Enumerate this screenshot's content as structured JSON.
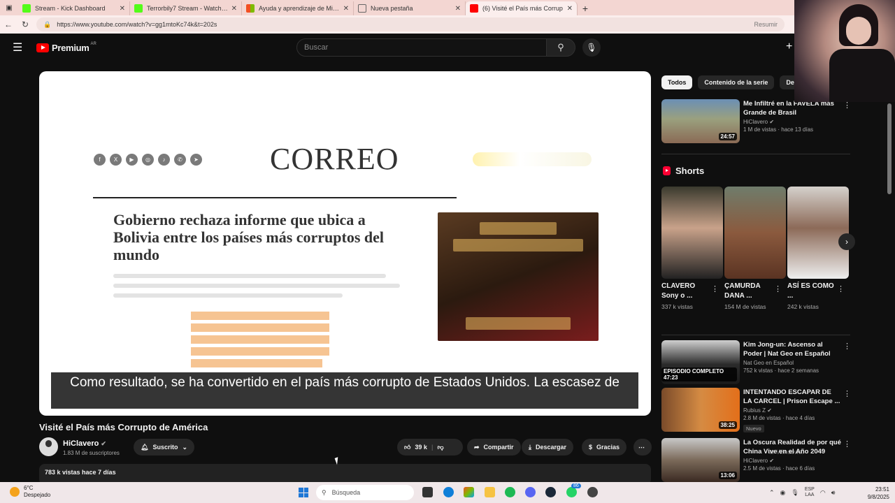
{
  "browser": {
    "tabs": [
      {
        "title": "Stream - Kick Dashboard",
        "color": "#53fc18"
      },
      {
        "title": "Terrorbily7 Stream - Watch Live o",
        "color": "#53fc18"
      },
      {
        "title": "Ayuda y aprendizaje de Microsoft",
        "color": "#f25022"
      },
      {
        "title": "Nueva pestaña",
        "color": "#888888"
      },
      {
        "title": "(6) Visité el País más Corrup",
        "color": "#ff0000"
      }
    ],
    "url": "https://www.youtube.com/watch?v=gg1mtoKc74k&t=202s",
    "resumir": "Resumir"
  },
  "header": {
    "logo_text": "Premium",
    "logo_sup": "AR",
    "search_placeholder": "Buscar"
  },
  "video": {
    "subtitle": "Como resultado, se ha convertido en el país más corrupto de Estados Unidos.  La escasez de",
    "article_brand": "CORREO",
    "article_headline": "Gobierno rechaza informe que ubica a Bolivia entre los países más corruptos del mundo",
    "title": "Visité el País más Corrupto de América",
    "channel": "HiClavero",
    "subscribers": "1.83 M de suscriptores",
    "subscribe_label": "Suscrito",
    "likes": "39 k",
    "share_label": "Compartir",
    "download_label": "Descargar",
    "thanks_label": "Gracias",
    "views_date": "783 k vistas  hace 7 días"
  },
  "sidebar": {
    "chips": [
      "Todos",
      "Contenido de la serie",
      "De Hi"
    ],
    "top_video": {
      "title": "Me Infiltré en la FAVELA mas Grande de Brasil",
      "channel": "HiClavero",
      "meta": "1 M de vistas · hace 13 días",
      "duration": "24:57"
    },
    "shorts_title": "Shorts",
    "shorts": [
      {
        "title": "CLAVERO Sony o ...",
        "views": "337 k vistas"
      },
      {
        "title": "ÇAMURDA DANA ...",
        "views": "154 M de vistas"
      },
      {
        "title": "ASÍ ES COMO ...",
        "views": "242 k vistas"
      }
    ],
    "videos": [
      {
        "title": "Kim Jong-un: Ascenso al Poder | Nat Geo en Español",
        "channel": "Nat Geo en Español",
        "meta": "752 k vistas · hace 2 semanas",
        "duration": "EPISODIO COMPLETO 47:23",
        "badge": ""
      },
      {
        "title": "INTENTANDO ESCAPAR DE LA CARCEL | Prison Escape ...",
        "channel": "Rubius Z",
        "meta": "2.8 M de vistas · hace 4 días",
        "duration": "38:25",
        "badge": "Nuevo"
      },
      {
        "title": "La Oscura Realidad de por qué China Vive en el Año 2049",
        "channel": "HiClavero",
        "meta": "2.5 M de vistas · hace 6 días",
        "duration": "13:06",
        "badge": ""
      }
    ]
  },
  "taskbar": {
    "temp": "6°C",
    "weather": "Despejado",
    "search": "Búsqueda",
    "lang1": "ESP",
    "lang2": "LAA",
    "time": "23:51",
    "date": "9/8/2025",
    "badge": "86"
  },
  "watermark": "ar Windows."
}
